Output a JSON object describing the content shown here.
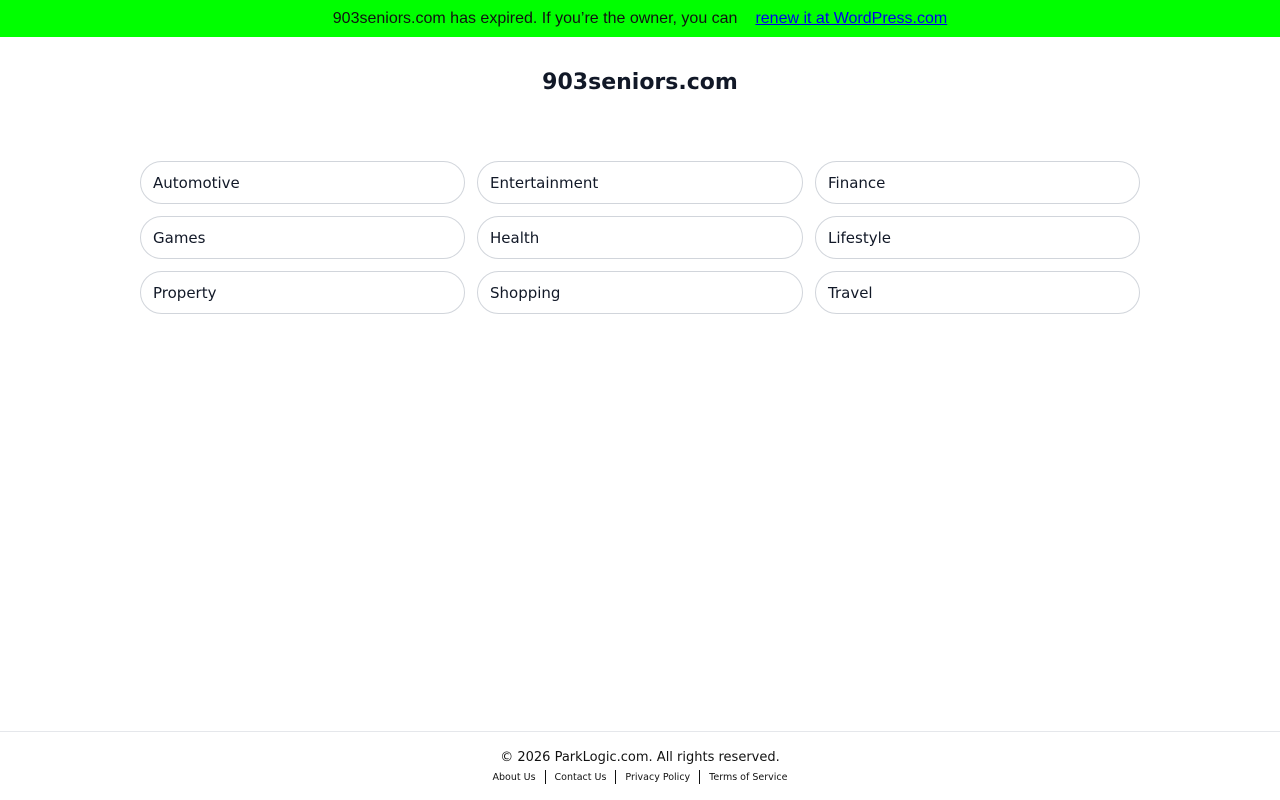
{
  "banner": {
    "message": "903seniors.com has expired. If you’re the owner, you can",
    "link_label": "renew it at WordPress.com",
    "bg_color": "#00ff00"
  },
  "site": {
    "title": "903seniors.com"
  },
  "categories": [
    "Automotive",
    "Entertainment",
    "Finance",
    "Games",
    "Health",
    "Lifestyle",
    "Property",
    "Shopping",
    "Travel"
  ],
  "footer": {
    "copyright": "© 2026 ParkLogic.com. All rights reserved.",
    "links": [
      "About Us",
      "Contact Us",
      "Privacy Policy",
      "Terms of Service"
    ]
  }
}
